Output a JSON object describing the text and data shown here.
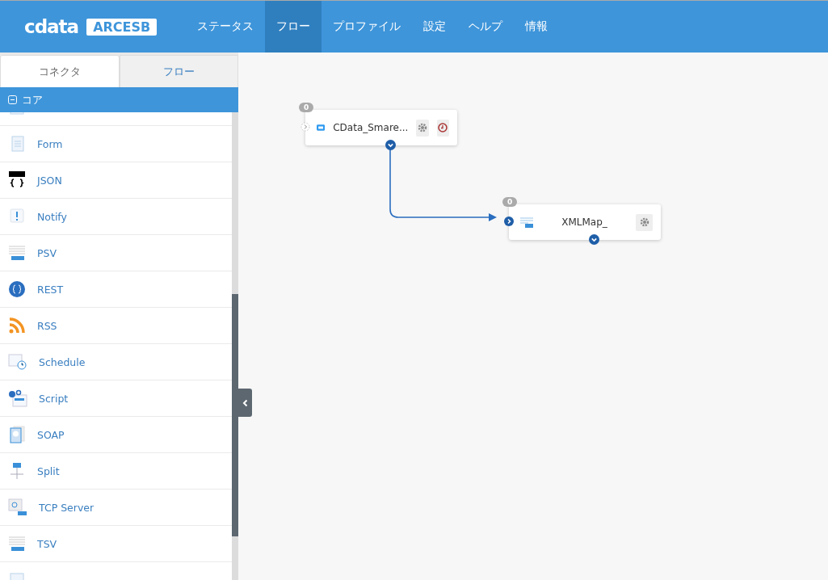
{
  "header": {
    "logo": {
      "wordmark": "cdata",
      "badge": "ARCESB"
    },
    "nav": [
      {
        "label": "ステータス",
        "selected": false
      },
      {
        "label": "フロー",
        "selected": true
      },
      {
        "label": "プロファイル",
        "selected": false
      },
      {
        "label": "設定",
        "selected": false
      },
      {
        "label": "ヘルプ",
        "selected": false
      },
      {
        "label": "情報",
        "selected": false
      }
    ]
  },
  "sidebar": {
    "tabs": [
      {
        "label": "コネクタ",
        "selected": true
      },
      {
        "label": "フロー",
        "selected": false
      }
    ],
    "section": {
      "label": "コア",
      "expanded": true
    },
    "items": [
      {
        "kind": "file"
      },
      {
        "kind": "form",
        "label": "Form"
      },
      {
        "kind": "json",
        "label": "JSON"
      },
      {
        "kind": "notify",
        "label": "Notify"
      },
      {
        "kind": "psv",
        "label": "PSV"
      },
      {
        "kind": "rest",
        "label": "REST"
      },
      {
        "kind": "rss",
        "label": "RSS"
      },
      {
        "kind": "schedule",
        "label": "Schedule"
      },
      {
        "kind": "script",
        "label": "Script"
      },
      {
        "kind": "soap",
        "label": "SOAP"
      },
      {
        "kind": "split",
        "label": "Split"
      },
      {
        "kind": "tcp",
        "label": "TCP Server"
      },
      {
        "kind": "tsv",
        "label": "TSV"
      },
      {
        "kind": "file"
      }
    ]
  },
  "canvas": {
    "nodes": [
      {
        "kind": "source",
        "count": "0",
        "name": "CData_Smare...",
        "schedule": true
      },
      {
        "kind": "map",
        "count": "0",
        "name": "XMLMap_",
        "schedule": false
      }
    ]
  }
}
